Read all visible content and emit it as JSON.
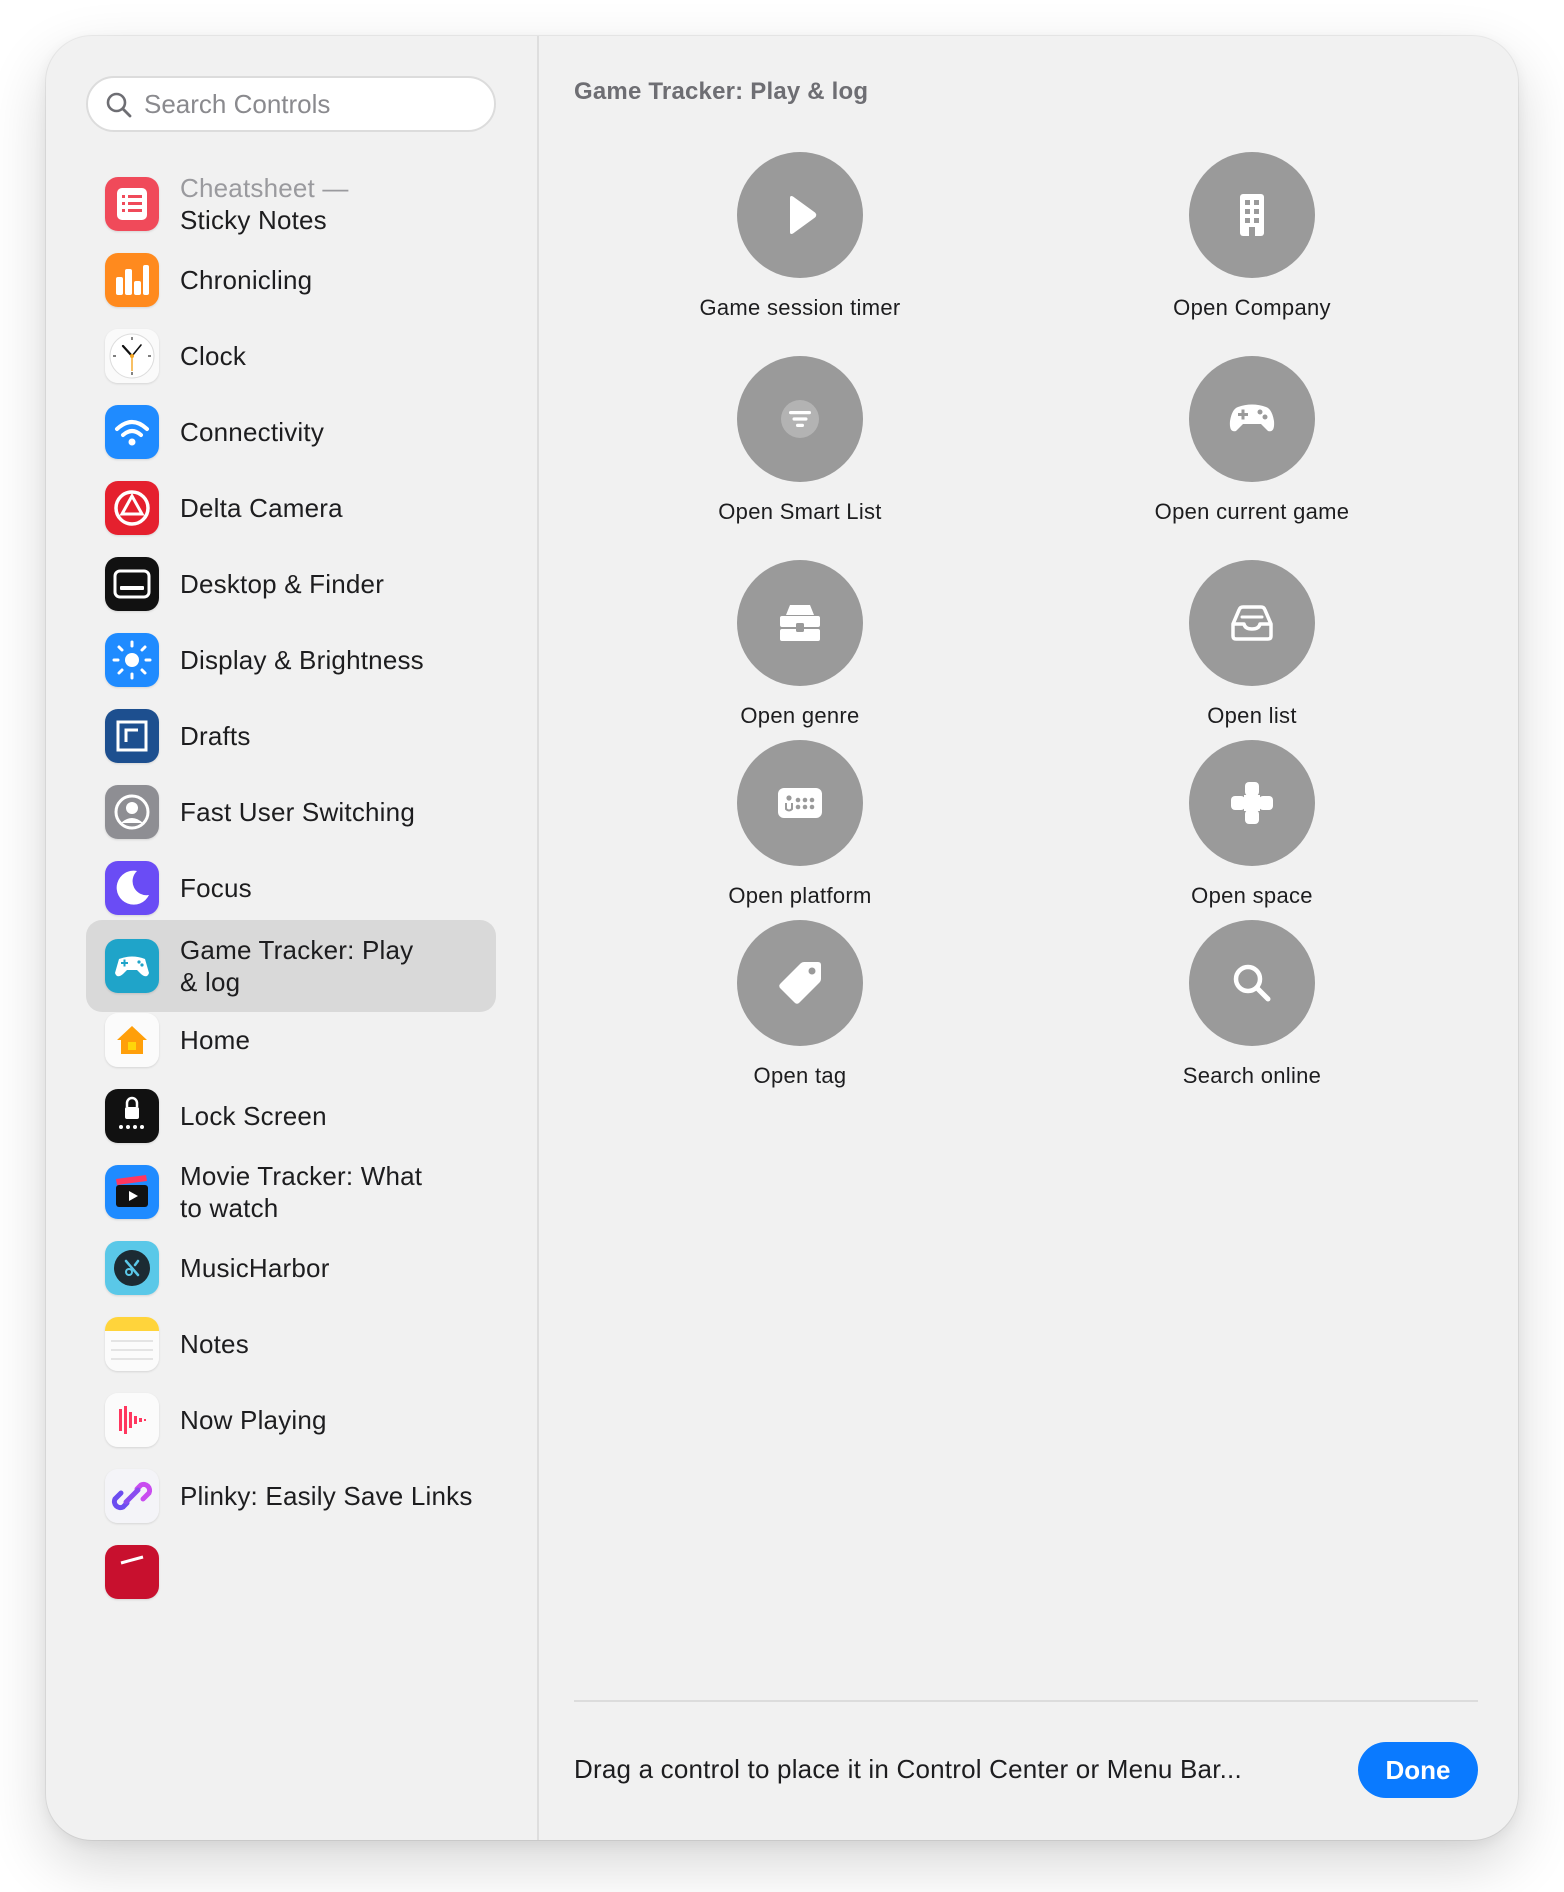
{
  "search": {
    "placeholder": "Search Controls"
  },
  "sidebar": {
    "items": [
      {
        "label_line1": "Cheatsheet —",
        "label_line2": "Sticky Notes",
        "icon": "cheatsheet-app-icon"
      },
      {
        "label_line1": "Chronicling",
        "label_line2": "",
        "icon": "chronicling-app-icon"
      },
      {
        "label_line1": "Clock",
        "label_line2": "",
        "icon": "clock-app-icon"
      },
      {
        "label_line1": "Connectivity",
        "label_line2": "",
        "icon": "wifi-app-icon"
      },
      {
        "label_line1": "Delta Camera",
        "label_line2": "",
        "icon": "delta-camera-app-icon"
      },
      {
        "label_line1": "Desktop & Finder",
        "label_line2": "",
        "icon": "desktop-app-icon"
      },
      {
        "label_line1": "Display & Brightness",
        "label_line2": "",
        "icon": "brightness-app-icon"
      },
      {
        "label_line1": "Drafts",
        "label_line2": "",
        "icon": "drafts-app-icon"
      },
      {
        "label_line1": "Fast User Switching",
        "label_line2": "",
        "icon": "user-switching-app-icon"
      },
      {
        "label_line1": "Focus",
        "label_line2": "",
        "icon": "focus-moon-app-icon"
      },
      {
        "label_line1": "Game Tracker: Play",
        "label_line2": "& log",
        "icon": "game-tracker-app-icon"
      },
      {
        "label_line1": "Home",
        "label_line2": "",
        "icon": "home-app-icon"
      },
      {
        "label_line1": "Lock Screen",
        "label_line2": "",
        "icon": "lock-screen-app-icon"
      },
      {
        "label_line1": "Movie Tracker: What",
        "label_line2": "to watch",
        "icon": "movie-tracker-app-icon"
      },
      {
        "label_line1": "MusicHarbor",
        "label_line2": "",
        "icon": "musicharbor-app-icon"
      },
      {
        "label_line1": "Notes",
        "label_line2": "",
        "icon": "notes-app-icon"
      },
      {
        "label_line1": "Now Playing",
        "label_line2": "",
        "icon": "now-playing-app-icon"
      },
      {
        "label_line1": "Plinky: Easily Save Links",
        "label_line2": "",
        "icon": "plinky-app-icon"
      }
    ]
  },
  "main": {
    "section_title": "Game Tracker: Play & log",
    "controls": [
      {
        "label": "Game session timer",
        "icon": "play-icon"
      },
      {
        "label": "Open Company",
        "icon": "building-icon"
      },
      {
        "label": "Open Smart List",
        "icon": "filter-list-icon"
      },
      {
        "label": "Open current game",
        "icon": "gamecontroller-icon"
      },
      {
        "label": "Open genre",
        "icon": "archivebox-icon"
      },
      {
        "label": "Open list",
        "icon": "tray-icon"
      },
      {
        "label": "Open platform",
        "icon": "keyboard-icon"
      },
      {
        "label": "Open space",
        "icon": "dpad-icon"
      },
      {
        "label": "Open tag",
        "icon": "tag-icon"
      },
      {
        "label": "Search online",
        "icon": "magnifyingglass-icon"
      }
    ]
  },
  "footer": {
    "hint": "Drag a control to place it in Control Center or Menu Bar...",
    "done_label": "Done"
  },
  "colors": {
    "accent": "#0a7aff",
    "control_circle": "#9a9a9a",
    "selected_row": "#d9d9d9"
  }
}
